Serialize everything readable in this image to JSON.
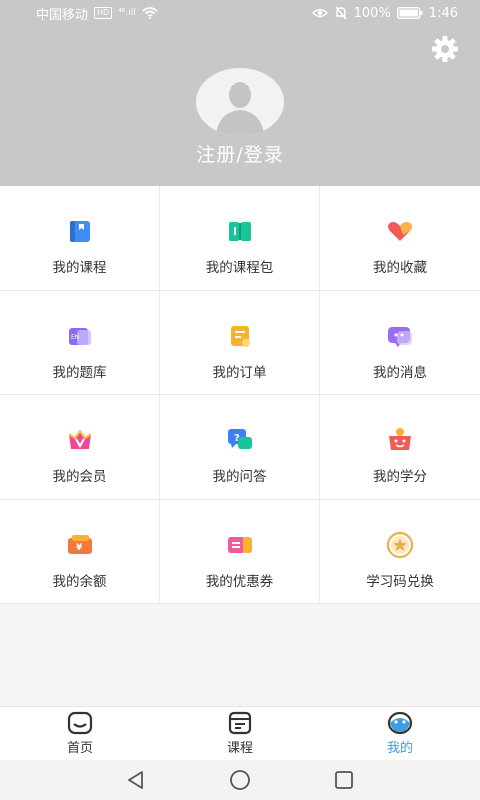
{
  "status_bar": {
    "carrier": "中国移动",
    "hd": "HD",
    "signal": "⁴⁶.ıll",
    "battery": "100%",
    "time": "1:46"
  },
  "header": {
    "login_text": "注册/登录",
    "settings_icon": "gear-icon",
    "avatar_icon": "default-avatar-icon"
  },
  "menu": [
    {
      "name": "courses",
      "label": "我的课程",
      "icon": "book-icon",
      "color": "#3d8ff5"
    },
    {
      "name": "course-packages",
      "label": "我的课程包",
      "icon": "open-book-icon",
      "color": "#19c49a"
    },
    {
      "name": "favorites",
      "label": "我的收藏",
      "icon": "heart-icon",
      "color": "#f25a5a"
    },
    {
      "name": "question-bank",
      "label": "我的题库",
      "icon": "question-bank-icon",
      "color": "#8a6cf2"
    },
    {
      "name": "orders",
      "label": "我的订单",
      "icon": "order-icon",
      "color": "#f7b32b"
    },
    {
      "name": "messages",
      "label": "我的消息",
      "icon": "message-icon",
      "color": "#9b6cf2"
    },
    {
      "name": "membership",
      "label": "我的会员",
      "icon": "vip-crown-icon",
      "color": "#f0479a"
    },
    {
      "name": "qa",
      "label": "我的问答",
      "icon": "qa-bubble-icon",
      "color": "#3d7ff5"
    },
    {
      "name": "credits",
      "label": "我的学分",
      "icon": "credit-basket-icon",
      "color": "#f25a5a"
    },
    {
      "name": "balance",
      "label": "我的余额",
      "icon": "wallet-icon",
      "color": "#f2793a"
    },
    {
      "name": "coupons",
      "label": "我的优惠券",
      "icon": "coupon-icon",
      "color": "#f05a9a"
    },
    {
      "name": "redeem-code",
      "label": "学习码兑换",
      "icon": "star-medal-icon",
      "color": "#e8b04a"
    }
  ],
  "bottom_nav": [
    {
      "name": "home",
      "label": "首页",
      "icon": "home-icon",
      "active": false
    },
    {
      "name": "courses",
      "label": "课程",
      "icon": "course-list-icon",
      "active": false
    },
    {
      "name": "mine",
      "label": "我的",
      "icon": "mine-face-icon",
      "active": true
    }
  ],
  "colors": {
    "header_bg": "#c8c8c8",
    "active_tab": "#3b9de0"
  }
}
